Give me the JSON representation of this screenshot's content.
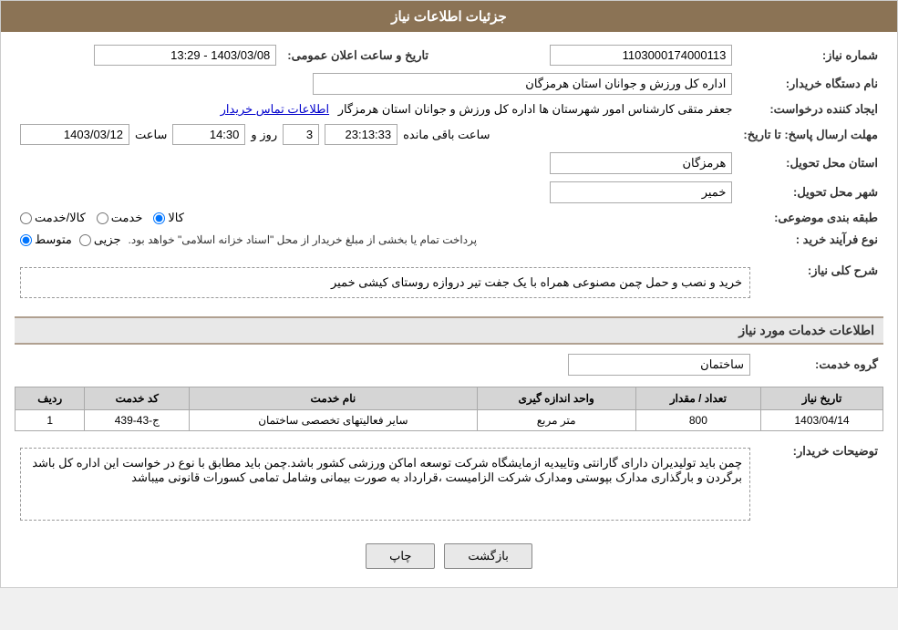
{
  "header": {
    "title": "جزئیات اطلاعات نیاز"
  },
  "fields": {
    "request_number_label": "شماره نیاز:",
    "request_number_value": "1103000174000113",
    "buyer_org_label": "نام دستگاه خریدار:",
    "buyer_org_value": "اداره کل ورزش و جوانان استان هرمزگان",
    "requester_label": "ایجاد کننده درخواست:",
    "requester_value": "جعفر متقی کارشناس امور شهرستان ها اداره کل ورزش و جوانان استان هرمزگار",
    "contact_link": "اطلاعات تماس خریدار",
    "send_date_label": "مهلت ارسال پاسخ: تا تاریخ:",
    "send_date_value": "1403/03/12",
    "send_time_label": "ساعت",
    "send_time_value": "14:30",
    "send_days_label": "روز و",
    "send_days_value": "3",
    "send_remaining_label": "ساعت باقی مانده",
    "send_remaining_value": "23:13:33",
    "announce_label": "تاریخ و ساعت اعلان عمومی:",
    "announce_value": "1403/03/08 - 13:29",
    "province_label": "استان محل تحویل:",
    "province_value": "هرمزگان",
    "city_label": "شهر محل تحویل:",
    "city_value": "خمیر",
    "category_label": "طبقه بندی موضوعی:",
    "category_kala": "کالا",
    "category_khedmat": "خدمت",
    "category_kala_khedmat": "کالا/خدمت",
    "category_selected": "کالا",
    "process_label": "نوع فرآیند خرید :",
    "process_jozee": "جزیی",
    "process_motavaset": "متوسط",
    "process_note": "پرداخت تمام یا بخشی از مبلغ خریدار از محل \"اسناد خزانه اسلامی\" خواهد بود.",
    "process_selected": "متوسط",
    "description_label": "شرح کلی نیاز:",
    "description_value": "خرید و نصب و حمل چمن مصنوعی همراه با یک جفت تیر دروازه روستای کیشی خمیر",
    "services_section_label": "اطلاعات خدمات مورد نیاز",
    "service_group_label": "گروه خدمت:",
    "service_group_value": "ساختمان",
    "table": {
      "col_row": "ردیف",
      "col_code": "کد خدمت",
      "col_name": "نام خدمت",
      "col_unit": "واحد اندازه گیری",
      "col_quantity": "تعداد / مقدار",
      "col_date": "تاریخ نیاز",
      "rows": [
        {
          "row": "1",
          "code": "ج-43-439",
          "name": "سایر فعالیتهای تخصصی ساختمان",
          "unit": "متر مربع",
          "quantity": "800",
          "date": "1403/04/14"
        }
      ]
    },
    "buyer_notes_label": "توضیحات خریدار:",
    "buyer_notes_value": "چمن باید تولیدیران دارای گارانتی وتاییدیه ازمایشگاه شرکت توسعه اماکن ورزشی کشور باشد.چمن باید مطابق با نوع در خواست این اداره کل باشد برگردن و بارگذاری مدارک بپوستی  ومدارک شرکت الزامیست ،قرارداد به صورت بیمانی وشامل تمامی کسورات قانونی میباشد"
  },
  "buttons": {
    "print": "چاپ",
    "back": "بازگشت"
  }
}
